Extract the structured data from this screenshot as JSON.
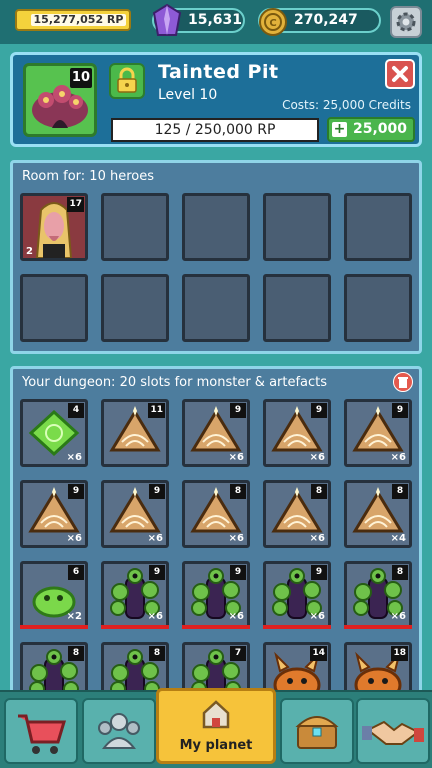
{
  "topbar": {
    "rp_value": "15,277,052 RP",
    "gems": "15,631",
    "credits": "270,247"
  },
  "room": {
    "level_badge": "10",
    "name": "Tainted Pit",
    "level_text": "Level 10",
    "costs_text": "Costs: 25,000 Credits",
    "progress_text": "125 / 250,000 RP",
    "buy_label": "25,000"
  },
  "heroes": {
    "title": "Room for: 10 heroes",
    "slots": [
      {
        "filled": true,
        "level": "17",
        "small_count": "2",
        "icon": "hero-girl-icon"
      },
      {
        "filled": false
      },
      {
        "filled": false
      },
      {
        "filled": false
      },
      {
        "filled": false
      },
      {
        "filled": false
      },
      {
        "filled": false
      },
      {
        "filled": false
      },
      {
        "filled": false
      },
      {
        "filled": false
      }
    ]
  },
  "dungeon": {
    "title": "Your dungeon: 20 slots for monster & artefacts",
    "items": [
      {
        "level": "4",
        "qty": "×6",
        "icon": "green-rune-icon",
        "hp": false
      },
      {
        "level": "11",
        "qty": "",
        "icon": "pyramid-artefact-icon",
        "hp": false
      },
      {
        "level": "9",
        "qty": "×6",
        "icon": "pyramid-artefact-icon",
        "hp": false
      },
      {
        "level": "9",
        "qty": "×6",
        "icon": "pyramid-artefact-icon",
        "hp": false
      },
      {
        "level": "9",
        "qty": "×6",
        "icon": "pyramid-artefact-icon",
        "hp": false
      },
      {
        "level": "9",
        "qty": "×6",
        "icon": "pyramid-artefact-icon",
        "hp": false
      },
      {
        "level": "9",
        "qty": "×6",
        "icon": "pyramid-artefact-icon",
        "hp": false
      },
      {
        "level": "8",
        "qty": "×6",
        "icon": "pyramid-artefact-icon",
        "hp": false
      },
      {
        "level": "8",
        "qty": "×6",
        "icon": "pyramid-artefact-icon",
        "hp": false
      },
      {
        "level": "8",
        "qty": "×4",
        "icon": "pyramid-artefact-icon",
        "hp": false
      },
      {
        "level": "6",
        "qty": "×2",
        "icon": "green-slime-icon",
        "hp": true
      },
      {
        "level": "9",
        "qty": "×6",
        "icon": "tentacle-monster-icon",
        "hp": true
      },
      {
        "level": "9",
        "qty": "×6",
        "icon": "tentacle-monster-icon",
        "hp": true
      },
      {
        "level": "9",
        "qty": "×6",
        "icon": "tentacle-monster-icon",
        "hp": true
      },
      {
        "level": "8",
        "qty": "×6",
        "icon": "tentacle-monster-icon",
        "hp": true
      },
      {
        "level": "8",
        "qty": "",
        "icon": "tentacle-monster-icon",
        "hp": false
      },
      {
        "level": "8",
        "qty": "",
        "icon": "tentacle-monster-icon",
        "hp": false
      },
      {
        "level": "7",
        "qty": "",
        "icon": "tentacle-monster-icon",
        "hp": false
      },
      {
        "level": "14",
        "qty": "",
        "icon": "orange-demon-icon",
        "hp": false
      },
      {
        "level": "18",
        "qty": "",
        "icon": "orange-demon-icon",
        "hp": false
      }
    ]
  },
  "nav": {
    "active_label": "My planet"
  }
}
